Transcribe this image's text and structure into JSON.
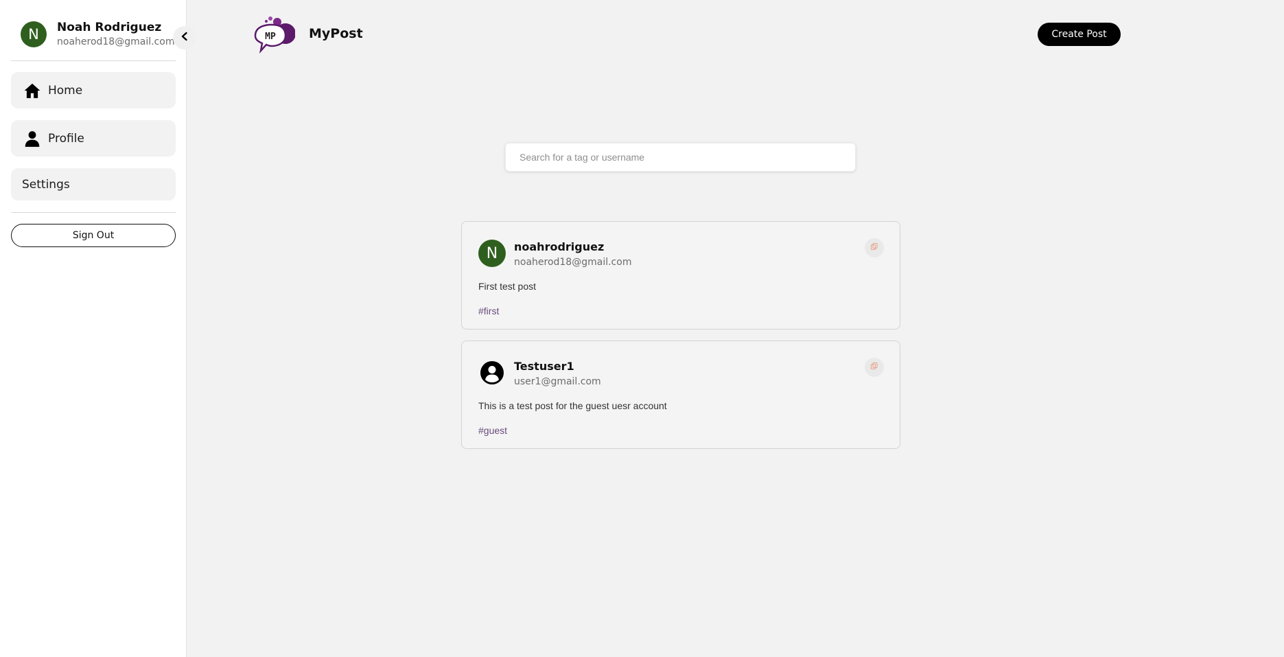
{
  "sidebar": {
    "user": {
      "initial": "N",
      "name": "Noah Rodriguez",
      "email": "noaherod18@gmail.com"
    },
    "nav": [
      {
        "label": "Home",
        "icon": "home-icon"
      },
      {
        "label": "Profile",
        "icon": "person-icon"
      },
      {
        "label": "Settings"
      }
    ],
    "signout_label": "Sign Out"
  },
  "header": {
    "logo_text": "MP",
    "brand": "MyPost",
    "create_label": "Create Post"
  },
  "search": {
    "placeholder": "Search for a tag or username",
    "value": ""
  },
  "posts": [
    {
      "initial": "N",
      "username": "noahrodriguez",
      "email": "noaherod18@gmail.com",
      "text": "First test post",
      "tag": "#first",
      "avatar_color": "#2f5f1e"
    },
    {
      "username": "Testuser1",
      "email": "user1@gmail.com",
      "text": "This is a test post for the guest uesr account",
      "tag": "#guest",
      "avatar": "account-circle-icon"
    }
  ],
  "colors": {
    "accent": "#000000",
    "avatar_green": "#2f5f1e",
    "tag": "#6a4a7c",
    "copy_icon": "#e8a489"
  }
}
